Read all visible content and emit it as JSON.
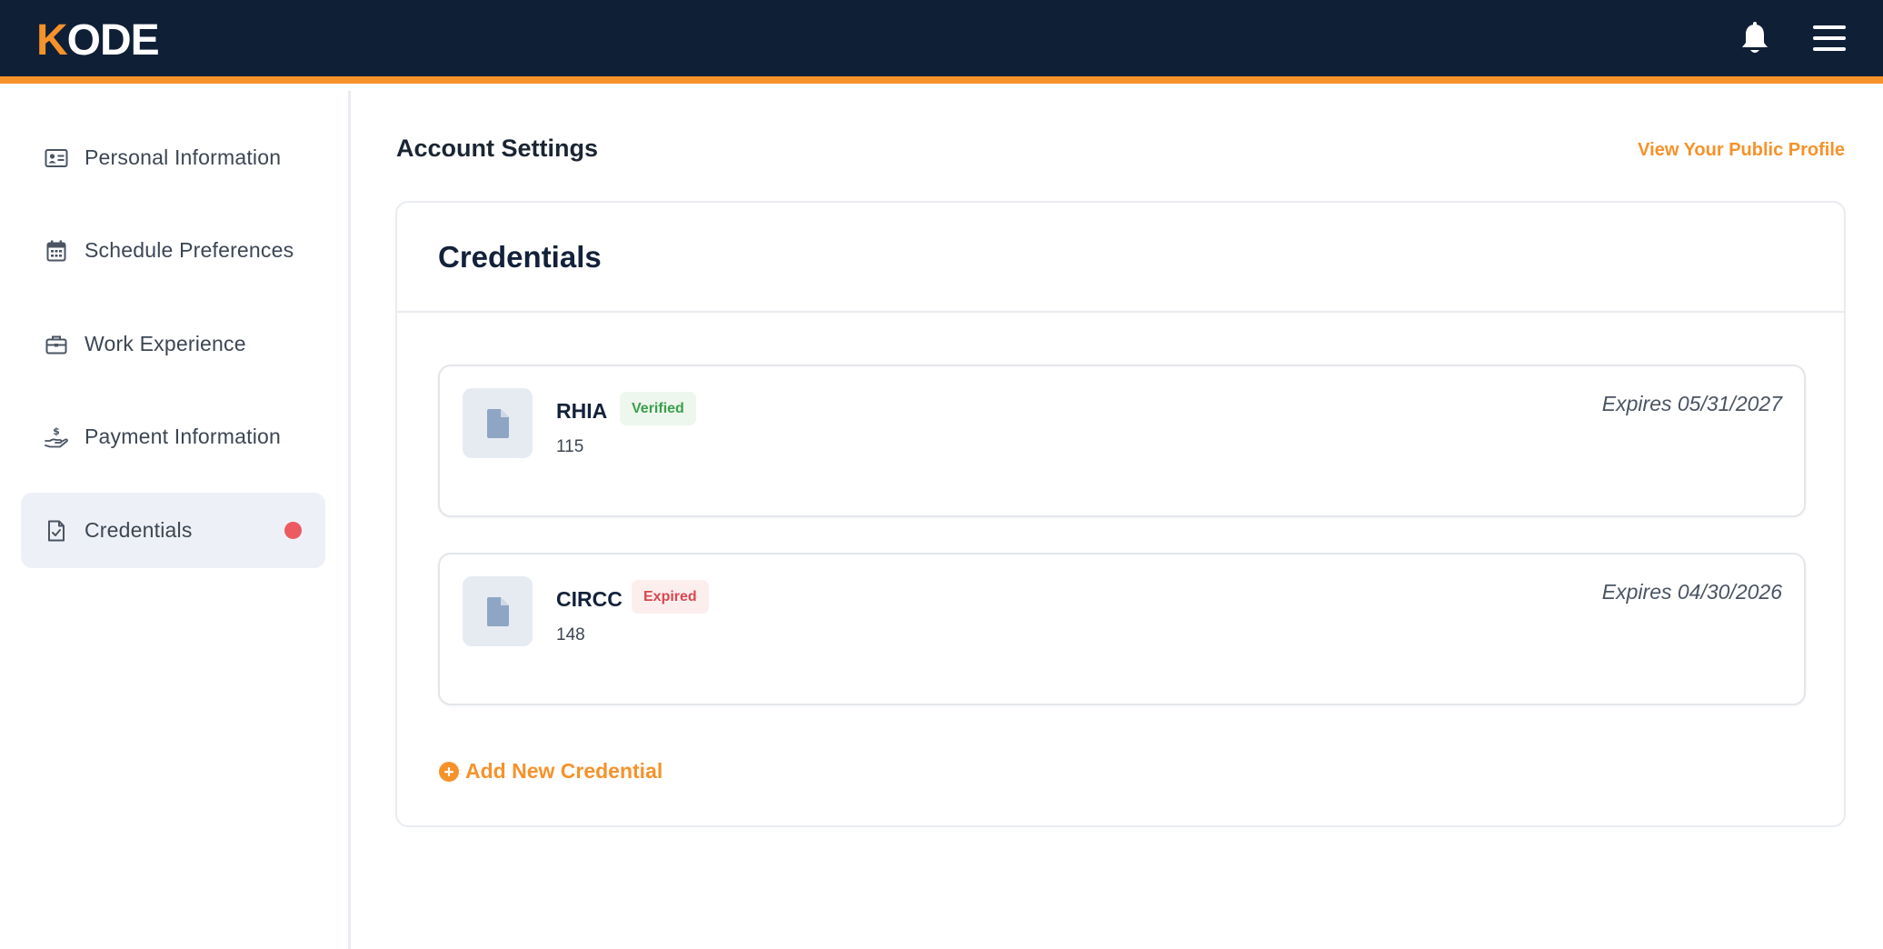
{
  "brand": {
    "logo_first": "K",
    "logo_rest": "ODE",
    "accent_color": "#f6922a",
    "header_color": "#0f1f36"
  },
  "header": {
    "notifications_icon": "bell-icon",
    "menu_icon": "hamburger-menu-icon"
  },
  "sidebar": {
    "items": [
      {
        "label": "Personal Information",
        "icon": "id-card-icon"
      },
      {
        "label": "Schedule Preferences",
        "icon": "calendar-icon"
      },
      {
        "label": "Work Experience",
        "icon": "briefcase-icon"
      },
      {
        "label": "Payment Information",
        "icon": "hand-dollar-icon"
      },
      {
        "label": "Credentials",
        "icon": "document-check-icon",
        "active": true,
        "alert_color": "#ec5b62"
      }
    ]
  },
  "main": {
    "title": "Account Settings",
    "public_profile_link": "View Your Public Profile",
    "card": {
      "title": "Credentials",
      "credentials": [
        {
          "name": "RHIA",
          "status": "Verified",
          "number": "115",
          "expires": "Expires 05/31/2027"
        },
        {
          "name": "CIRCC",
          "status": "Expired",
          "number": "148",
          "expires": "Expires 04/30/2026"
        }
      ],
      "add_label": "Add New Credential"
    }
  }
}
